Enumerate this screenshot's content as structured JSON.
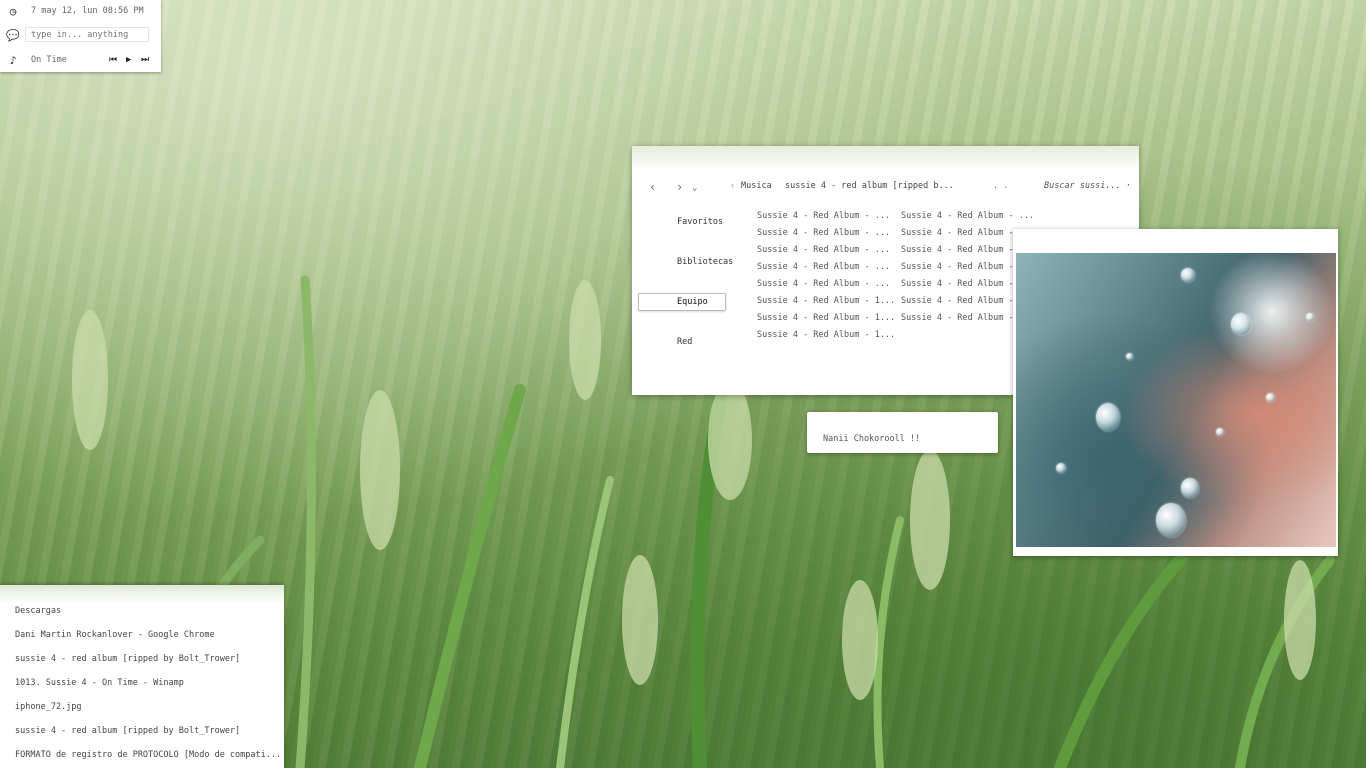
{
  "widget": {
    "clock": "7 may 12, lun 08:56 PM",
    "chat_placeholder": "type in... anything",
    "music_title": "On Time",
    "prev": "⏮",
    "play": "▶",
    "next": "⏭"
  },
  "explorer": {
    "back": "‹",
    "forward": "›",
    "history": "⌄",
    "crumb_arrow": "‹",
    "breadcrumb": [
      "Musica",
      "sussie 4 - red album [ripped b..."
    ],
    "dots": ".   .",
    "search": "Buscar sussi... ·",
    "nav": [
      "Favoritos",
      "Bibliotecas",
      "Equipo",
      "Red"
    ],
    "files_col1": [
      "Sussie 4 - Red Album - ...",
      "Sussie 4 - Red Album - ...",
      "Sussie 4 - Red Album - ...",
      "Sussie 4 - Red Album - ...",
      "Sussie 4 - Red Album - ...",
      "Sussie 4 - Red Album - 1...",
      "Sussie 4 - Red Album - 1...",
      "Sussie 4 - Red Album - 1..."
    ],
    "files_col2": [
      "Sussie 4 - Red Album - ...",
      "Sussie 4 - Red Album - ...",
      "Sussie 4 - Red Album - ...",
      "Sussie 4 - Red Album - ...",
      "Sussie 4 - Red Album - 1...",
      "Sussie 4 - Red Album - 1...",
      "Sussie 4 - Red Album - 1..."
    ]
  },
  "note": {
    "text": "Nanii Chokorooll !!"
  },
  "tasks": [
    "Descargas",
    "Dani Martin Rockanlover - Google Chrome",
    "sussie 4 - red album [ripped by Bolt_Trower]",
    "1013. Sussie 4 - On Time - Winamp",
    "iphone_72.jpg",
    "sussie 4 - red album [ripped by Bolt_Trower]",
    "FORMATO de registro de PROTOCOLO [Modo de compati..."
  ]
}
